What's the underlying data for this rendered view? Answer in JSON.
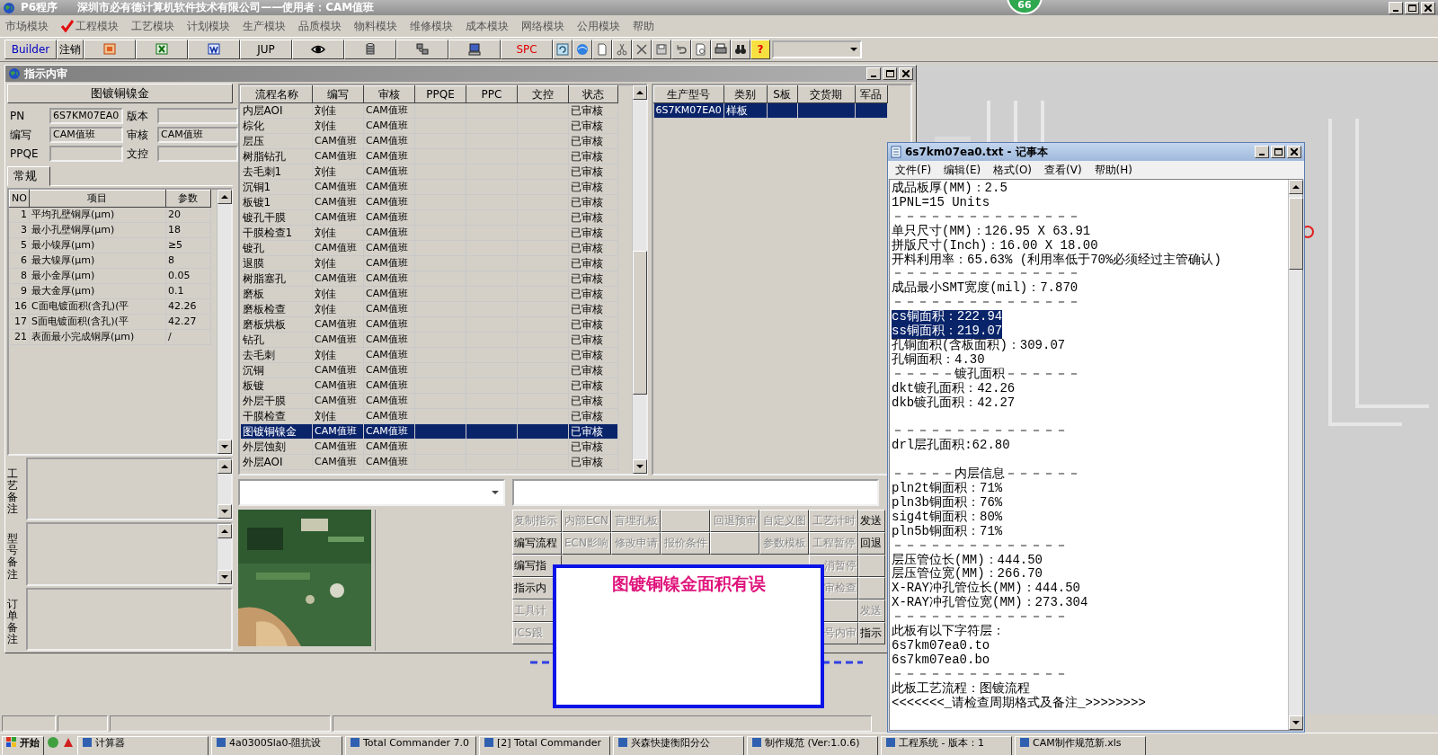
{
  "app_title": {
    "program": "P6程序",
    "company": "深圳市必有德计算机软件技术有限公司——使用者：CAM值班"
  },
  "badge": "66",
  "menu": [
    {
      "label": "市场模块",
      "checked": false
    },
    {
      "label": "工程模块",
      "checked": true
    },
    {
      "label": "工艺模块",
      "checked": false
    },
    {
      "label": "计划模块",
      "checked": false
    },
    {
      "label": "生产模块",
      "checked": false
    },
    {
      "label": "品质模块",
      "checked": false
    },
    {
      "label": "物料模块",
      "checked": false
    },
    {
      "label": "维修模块",
      "checked": false
    },
    {
      "label": "成本模块",
      "checked": false
    },
    {
      "label": "网络模块",
      "checked": false
    },
    {
      "label": "公用模块",
      "checked": false
    },
    {
      "label": "帮助",
      "checked": false
    }
  ],
  "toolbar": [
    {
      "kind": "text",
      "label": "Builder",
      "color": "#0000c0"
    },
    {
      "kind": "text",
      "label": "注销",
      "color": "#000000"
    },
    {
      "kind": "icon"
    },
    {
      "kind": "icon"
    },
    {
      "kind": "icon"
    },
    {
      "kind": "text",
      "label": "JUP",
      "color": "#000000"
    },
    {
      "kind": "icon"
    },
    {
      "kind": "icon"
    },
    {
      "kind": "icon"
    },
    {
      "kind": "icon"
    },
    {
      "kind": "text",
      "label": "SPC",
      "color": "#e00000"
    },
    {
      "kind": "small"
    },
    {
      "kind": "small"
    },
    {
      "kind": "small"
    },
    {
      "kind": "small"
    },
    {
      "kind": "small"
    },
    {
      "kind": "small"
    },
    {
      "kind": "small"
    },
    {
      "kind": "small"
    },
    {
      "kind": "small"
    },
    {
      "kind": "small"
    },
    {
      "kind": "help",
      "label": "?"
    }
  ],
  "child_window": {
    "title": "指示内审"
  },
  "left_panel": {
    "header": "图镀铜镍金",
    "fields": [
      {
        "label": "PN",
        "value": "6S7KM07EA0"
      },
      {
        "label": "版本"
      },
      {
        "label": "编写",
        "value": "CAM值班"
      },
      {
        "label": "审核",
        "value": "CAM值班"
      },
      {
        "label": "PPQE"
      },
      {
        "label": "文控"
      }
    ],
    "tabs": [
      {
        "label": "常规",
        "selected": true
      }
    ],
    "params": {
      "columns": [
        "NO",
        "项目",
        "参数"
      ],
      "rows": [
        [
          "1",
          "平均孔壁铜厚(μm)",
          "20"
        ],
        [
          "3",
          "最小孔壁铜厚(μm)",
          "18"
        ],
        [
          "5",
          "最小镍厚(μm)",
          "≥5"
        ],
        [
          "6",
          "最大镍厚(μm)",
          "8"
        ],
        [
          "8",
          "最小金厚(μm)",
          "0.05"
        ],
        [
          "9",
          "最大金厚(μm)",
          "0.1"
        ],
        [
          "16",
          "C面电镀面积(含孔)(平",
          "42.26"
        ],
        [
          "17",
          "S面电镀面积(含孔)(平",
          "42.27"
        ],
        [
          "21",
          "表面最小完成铜厚(μm)",
          "/"
        ]
      ]
    },
    "notes": [
      "工艺备注",
      "型号备注",
      "订单备注"
    ]
  },
  "flow_table": {
    "columns": [
      "流程名称",
      "编写",
      "审核",
      "PPQE",
      "PPC",
      "文控",
      "状态"
    ],
    "rows": [
      {
        "name": "内层AOI",
        "writer": "刘佳",
        "reviewer": "CAM值班",
        "status": "已审核",
        "selected": false
      },
      {
        "name": "棕化",
        "writer": "刘佳",
        "reviewer": "CAM值班",
        "status": "已审核",
        "selected": false
      },
      {
        "name": "层压",
        "writer": "CAM值班",
        "reviewer": "CAM值班",
        "status": "已审核",
        "selected": false
      },
      {
        "name": "树脂钻孔",
        "writer": "CAM值班",
        "reviewer": "CAM值班",
        "status": "已审核",
        "selected": false
      },
      {
        "name": "去毛刺1",
        "writer": "刘佳",
        "reviewer": "CAM值班",
        "status": "已审核",
        "selected": false
      },
      {
        "name": "沉铜1",
        "writer": "CAM值班",
        "reviewer": "CAM值班",
        "status": "已审核",
        "selected": false
      },
      {
        "name": "板镀1",
        "writer": "CAM值班",
        "reviewer": "CAM值班",
        "status": "已审核",
        "selected": false
      },
      {
        "name": "镀孔干膜",
        "writer": "CAM值班",
        "reviewer": "CAM值班",
        "status": "已审核",
        "selected": false
      },
      {
        "name": "干膜检查1",
        "writer": "刘佳",
        "reviewer": "CAM值班",
        "status": "已审核",
        "selected": false
      },
      {
        "name": "镀孔",
        "writer": "CAM值班",
        "reviewer": "CAM值班",
        "status": "已审核",
        "selected": false
      },
      {
        "name": "退膜",
        "writer": "刘佳",
        "reviewer": "CAM值班",
        "status": "已审核",
        "selected": false
      },
      {
        "name": "树脂塞孔",
        "writer": "CAM值班",
        "reviewer": "CAM值班",
        "status": "已审核",
        "selected": false
      },
      {
        "name": "磨板",
        "writer": "刘佳",
        "reviewer": "CAM值班",
        "status": "已审核",
        "selected": false
      },
      {
        "name": "磨板检查",
        "writer": "刘佳",
        "reviewer": "CAM值班",
        "status": "已审核",
        "selected": false
      },
      {
        "name": "磨板烘板",
        "writer": "CAM值班",
        "reviewer": "CAM值班",
        "status": "已审核",
        "selected": false
      },
      {
        "name": "钻孔",
        "writer": "CAM值班",
        "reviewer": "CAM值班",
        "status": "已审核",
        "selected": false
      },
      {
        "name": "去毛刺",
        "writer": "刘佳",
        "reviewer": "CAM值班",
        "status": "已审核",
        "selected": false
      },
      {
        "name": "沉铜",
        "writer": "CAM值班",
        "reviewer": "CAM值班",
        "status": "已审核",
        "selected": false
      },
      {
        "name": "板镀",
        "writer": "CAM值班",
        "reviewer": "CAM值班",
        "status": "已审核",
        "selected": false
      },
      {
        "name": "外层干膜",
        "writer": "CAM值班",
        "reviewer": "CAM值班",
        "status": "已审核",
        "selected": false
      },
      {
        "name": "干膜检查",
        "writer": "刘佳",
        "reviewer": "CAM值班",
        "status": "已审核",
        "selected": false
      },
      {
        "name": "图镀铜镍金",
        "writer": "CAM值班",
        "reviewer": "CAM值班",
        "status": "已审核",
        "selected": true
      },
      {
        "name": "外层蚀刻",
        "writer": "CAM值班",
        "reviewer": "CAM值班",
        "status": "已审核",
        "selected": false
      },
      {
        "name": "外层AOI",
        "writer": "CAM值班",
        "reviewer": "CAM值班",
        "status": "已审核",
        "selected": false
      }
    ]
  },
  "product_table": {
    "columns": [
      "生产型号",
      "类别",
      "S板",
      "交货期",
      "军品"
    ],
    "rows": [
      {
        "model": "6S7KM07EA0",
        "category": "样板",
        "selected": true
      }
    ]
  },
  "action_buttons": [
    [
      {
        "kind": "button",
        "label": "复制指示",
        "disabled": true
      },
      {
        "kind": "button",
        "label": "内部ECN",
        "disabled": true
      },
      {
        "kind": "button",
        "label": "盲埋孔板",
        "disabled": true
      },
      {
        "kind": "blank"
      },
      {
        "kind": "button",
        "label": "回退预审",
        "disabled": true
      },
      {
        "kind": "button",
        "label": "自定义图",
        "disabled": true
      },
      {
        "kind": "button",
        "label": "工艺计时",
        "disabled": true
      },
      {
        "kind": "button",
        "label": "发送",
        "disabled": false
      }
    ],
    [
      {
        "kind": "button",
        "label": "编写流程",
        "disabled": false
      },
      {
        "kind": "button",
        "label": "ECN影响",
        "disabled": true
      },
      {
        "kind": "button",
        "label": "修改申请",
        "disabled": true
      },
      {
        "kind": "button",
        "label": "报价条件",
        "disabled": true
      },
      {
        "kind": "blank"
      },
      {
        "kind": "button",
        "label": "参数模板",
        "disabled": true
      },
      {
        "kind": "button",
        "label": "工程暂停",
        "disabled": true
      },
      {
        "kind": "button",
        "label": "回退",
        "disabled": false
      }
    ],
    [
      {
        "kind": "button",
        "label": "编写指",
        "disabled": false
      },
      {
        "kind": "button",
        "label": "消暂停",
        "disabled": true
      },
      {
        "kind": "blank"
      }
    ],
    [
      {
        "kind": "button",
        "label": "指示内",
        "disabled": false
      },
      {
        "kind": "button",
        "label": "审检查",
        "disabled": true
      },
      {
        "kind": "blank"
      }
    ],
    [
      {
        "kind": "button",
        "label": "工具计",
        "disabled": true
      },
      {
        "kind": "blank"
      },
      {
        "kind": "button",
        "label": "发送",
        "disabled": true
      }
    ],
    [
      {
        "kind": "button",
        "label": "ICS跟",
        "disabled": true
      },
      {
        "kind": "button",
        "label": "号内审",
        "disabled": true
      },
      {
        "kind": "button",
        "label": "指示",
        "disabled": false
      }
    ]
  ],
  "alert": {
    "message": "图镀铜镍金面积有误"
  },
  "notepad": {
    "title": "6s7km07ea0.txt - 记事本",
    "menu": [
      "文件(F)",
      "编辑(E)",
      "格式(O)",
      "查看(V)",
      "帮助(H)"
    ],
    "lines": [
      {
        "text": "成品板厚(MM)：2.5",
        "selected": false
      },
      {
        "text": "1PNL=15 Units",
        "selected": false
      },
      {
        "text": "－－－－－－－－－－－－－－－",
        "selected": false
      },
      {
        "text": "单只尺寸(MM)：126.95 X 63.91",
        "selected": false
      },
      {
        "text": "拼版尺寸(Inch)：16.00 X 18.00",
        "selected": false
      },
      {
        "text": "开料利用率：65.63% (利用率低于70%必须经过主管确认)",
        "selected": false
      },
      {
        "text": "－－－－－－－－－－－－－－－",
        "selected": false
      },
      {
        "text": "成品最小SMT宽度(mil)：7.870",
        "selected": false
      },
      {
        "text": "－－－－－－－－－－－－－－－",
        "selected": false
      },
      {
        "text": "cs铜面积：222.94",
        "selected": true
      },
      {
        "text": "ss铜面积：219.07",
        "selected": true
      },
      {
        "text": "孔铜面积(含板面积)：309.07",
        "selected": false
      },
      {
        "text": "孔铜面积：4.30",
        "selected": false
      },
      {
        "text": "－－－－－镀孔面积－－－－－－",
        "selected": false
      },
      {
        "text": "dkt镀孔面积：42.26",
        "selected": false
      },
      {
        "text": "dkb镀孔面积：42.27",
        "selected": false
      },
      {
        "text": "－－－－－－－－－－－－－－",
        "selected": false,
        "blank_before": true
      },
      {
        "text": "drl层孔面积:62.80",
        "selected": false
      },
      {
        "text": "－－－－－内层信息－－－－－－",
        "selected": false,
        "blank_before": true
      },
      {
        "text": "pln2t铜面积：71%",
        "selected": false
      },
      {
        "text": "pln3b铜面积：76%",
        "selected": false
      },
      {
        "text": "sig4t铜面积：80%",
        "selected": false
      },
      {
        "text": "pln5b铜面积：71%",
        "selected": false
      },
      {
        "text": "－－－－－－－－－－－－－－",
        "selected": false
      },
      {
        "text": "层压管位长(MM)：444.50",
        "selected": false
      },
      {
        "text": "层压管位宽(MM)：266.70",
        "selected": false
      },
      {
        "text": "X-RAY冲孔管位长(MM)：444.50",
        "selected": false
      },
      {
        "text": "X-RAY冲孔管位宽(MM)：273.304",
        "selected": false
      },
      {
        "text": "－－－－－－－－－－－－－－",
        "selected": false
      },
      {
        "text": "此板有以下字符层：",
        "selected": false
      },
      {
        "text": "6s7km07ea0.to",
        "selected": false
      },
      {
        "text": "6s7km07ea0.bo",
        "selected": false
      },
      {
        "text": "－－－－－－－－－－－－－－",
        "selected": false
      },
      {
        "text": "此板工艺流程：图镀流程",
        "selected": false
      },
      {
        "text": "<<<<<<<_请检查周期格式及备注_>>>>>>>>",
        "selected": false
      }
    ]
  },
  "taskbar": {
    "start": "开始",
    "items": [
      "计算器",
      "4a0300Sla0-阻抗设",
      "Total Commander 7.0",
      "[2] Total Commander",
      "兴森快捷衡阳分公",
      "制作规范 (Ver:1.0.6)",
      "工程系统 - 版本：1",
      "CAM制作规范新.xls"
    ]
  }
}
